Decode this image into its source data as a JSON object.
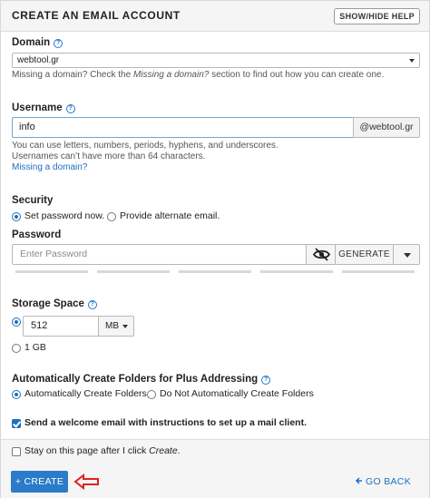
{
  "header": {
    "title": "CREATE AN EMAIL ACCOUNT",
    "help_button": "SHOW/HIDE HELP",
    "help_icon": "question-circle-icon"
  },
  "domain": {
    "label": "Domain",
    "value": "webtool.gr",
    "hint_prefix": "Missing a domain? Check the ",
    "hint_emph": "Missing a domain?",
    "hint_suffix": " section to find out how you can create one."
  },
  "username": {
    "label": "Username",
    "value": "info",
    "suffix": "@webtool.gr",
    "hint_line1": "You can use letters, numbers, periods, hyphens, and underscores.",
    "hint_line2": "Usernames can’t have more than 64 characters.",
    "missing_link": "Missing a domain?"
  },
  "security": {
    "label": "Security",
    "option_set_now": "Set password now.",
    "option_alternate": "Provide alternate email.",
    "selected": "Set password now."
  },
  "password": {
    "label": "Password",
    "placeholder": "Enter Password",
    "toggle_icon": "eye-slash-icon",
    "generate_label": "GENERATE",
    "strength_segments": 5
  },
  "storage": {
    "label": "Storage Space",
    "quantity": "512",
    "unit": "MB",
    "option_1gb": "1 GB",
    "selected": "custom"
  },
  "plus_addressing": {
    "label": "Automatically Create Folders for Plus Addressing",
    "option_auto": "Automatically Create Folders",
    "option_none": "Do Not Automatically Create Folders",
    "selected": "Automatically Create Folders"
  },
  "welcome_email": {
    "label": "Send a welcome email with instructions to set up a mail client.",
    "checked": true
  },
  "stay_on_page": {
    "label_prefix": "Stay on this page after I click ",
    "label_emph": "Create",
    "label_suffix": ".",
    "checked": false
  },
  "footer": {
    "create_label": "+ CREATE",
    "go_back_label": "GO BACK",
    "go_back_icon": "arrow-left-circle-icon",
    "annotation_icon": "red-arrow-left-icon"
  },
  "colors": {
    "accent": "#2a7bc8",
    "link": "#1f6fbf",
    "annotation": "#e02020"
  }
}
